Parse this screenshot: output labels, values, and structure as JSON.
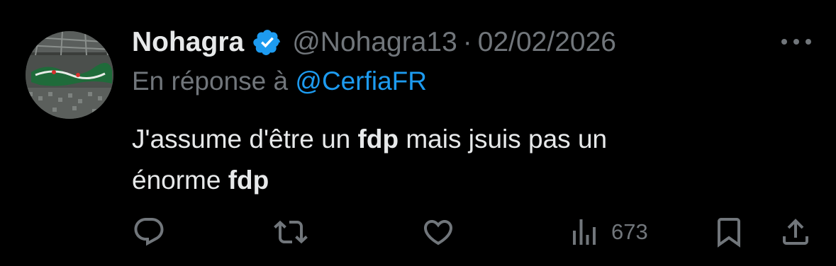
{
  "author": {
    "display_name": "Nohagra",
    "handle": "@Nohagra13",
    "separator": "·",
    "date": "02/02/2026",
    "verified": true,
    "avatar_icon": "avatar-stadium-tifo"
  },
  "reply": {
    "prefix": "En réponse à ",
    "mention": "@CerfiaFR"
  },
  "tweet": {
    "line1_a": "J'assume d'être un ",
    "line1_bold": "fdp",
    "line1_b": " mais jsuis pas un",
    "line2_a": "énorme ",
    "line2_bold": "fdp"
  },
  "actions": {
    "views_count": "673",
    "icons": [
      "reply-icon",
      "retweet-icon",
      "like-icon",
      "views-icon",
      "bookmark-icon",
      "share-icon"
    ]
  },
  "colors": {
    "background": "#000000",
    "primary_text": "#e7e9ea",
    "secondary_text": "#71767b",
    "accent": "#1d9bf0"
  }
}
